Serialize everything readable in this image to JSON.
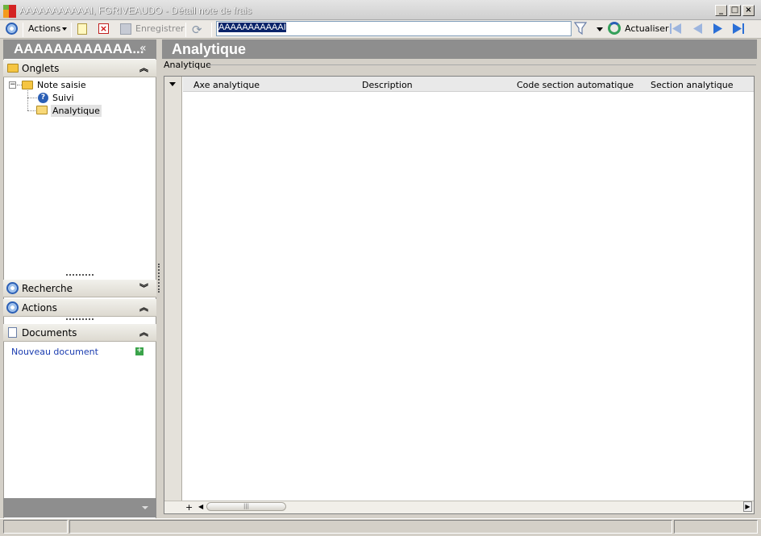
{
  "window": {
    "title": "AAAAAAAAAAAI, FGRIVEAUDO  -  Détail note de frais",
    "minimize_label": "_",
    "maximize_label": "□",
    "close_label": "×"
  },
  "toolbar": {
    "actions_label": "Actions",
    "save_label": "Enregistrer",
    "search_value": "AAAAAAAAAAAI",
    "refresh_label": "Actualiser"
  },
  "left_panel": {
    "record_title": "AAAAAAAAAAAA...",
    "collapse_icon": "«",
    "onglets_label": "Onglets",
    "tree": {
      "root_label": "Note saisie",
      "expander": "−",
      "children": [
        {
          "label": "Suivi",
          "icon": "?"
        },
        {
          "label": "Analytique"
        }
      ]
    },
    "recherche_label": "Recherche",
    "actions_label": "Actions",
    "documents_label": "Documents",
    "new_document_label": "Nouveau document",
    "chevron_up": "⌃",
    "chevron_down": "⌄"
  },
  "main": {
    "title": "Analytique",
    "section_label": "Analytique",
    "columns": [
      "Axe analytique",
      "Description",
      "Code section automatique",
      "Section analytique"
    ],
    "add_row_label": "+",
    "scroll_left_label": "◀",
    "scroll_right_label": "▶",
    "scroll_thumb_label": "|||"
  },
  "colors": {
    "header_gray": "#8e8e8e",
    "link_blue": "#1a3cb0",
    "accent_blue": "#2b5fb5"
  }
}
